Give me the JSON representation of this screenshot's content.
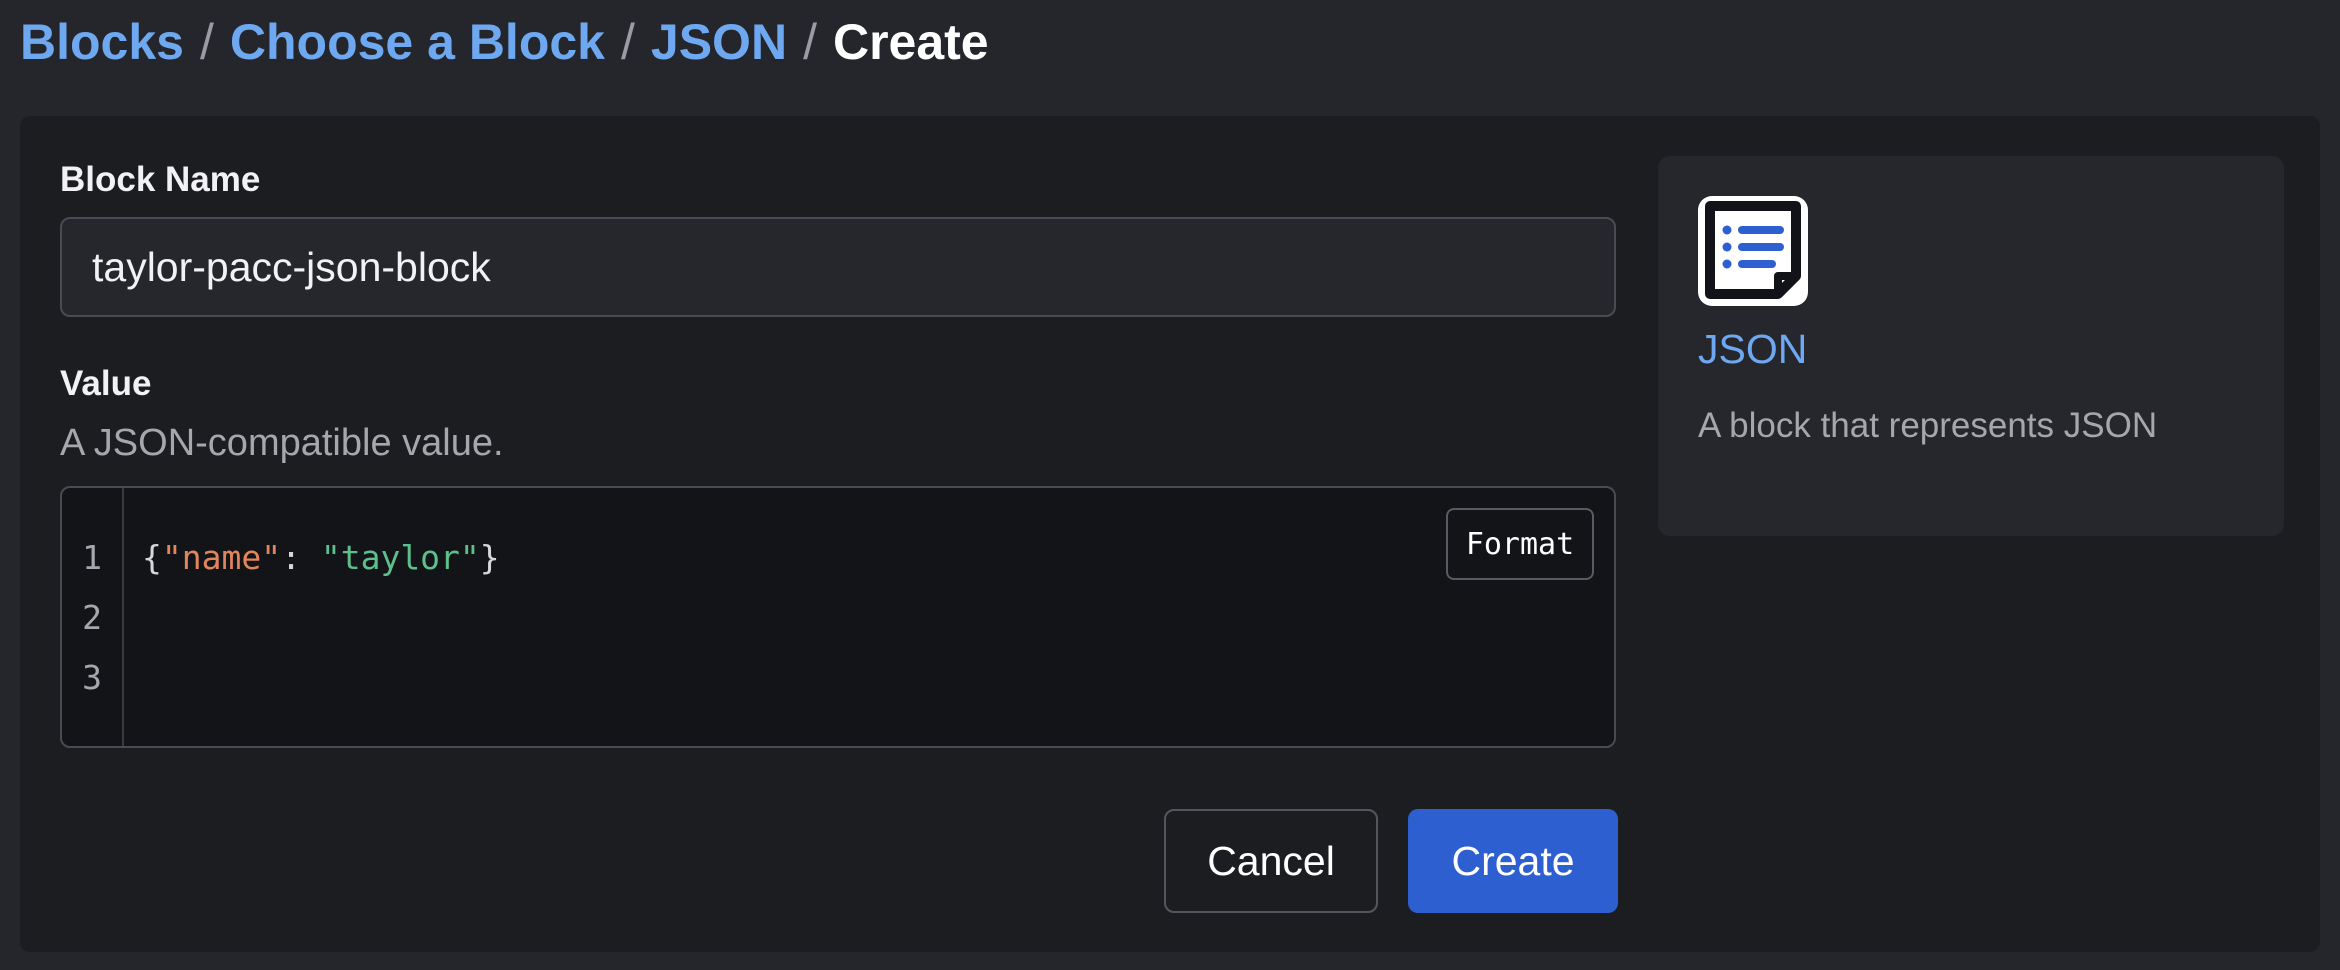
{
  "breadcrumb": {
    "items": [
      "Blocks",
      "Choose a Block",
      "JSON"
    ],
    "separator": "/",
    "current": "Create"
  },
  "form": {
    "name_label": "Block Name",
    "name_value": "taylor-pacc-json-block",
    "value_label": "Value",
    "value_description": "A JSON-compatible value.",
    "editor": {
      "line_numbers": [
        "1",
        "2",
        "3"
      ],
      "code": {
        "open_brace": "{",
        "key": "\"name\"",
        "colon": ": ",
        "value": "\"taylor\"",
        "close_brace": "}"
      },
      "format_label": "Format"
    },
    "cancel_label": "Cancel",
    "create_label": "Create"
  },
  "block_info": {
    "icon": "list-document-icon",
    "title": "JSON",
    "description": "A block that represents JSON"
  },
  "colors": {
    "link": "#6ea8f0",
    "primary_button": "#2e5fd0",
    "json_key": "#e2855c",
    "json_string": "#5cbf8c",
    "icon_accent": "#2e5fd0"
  }
}
